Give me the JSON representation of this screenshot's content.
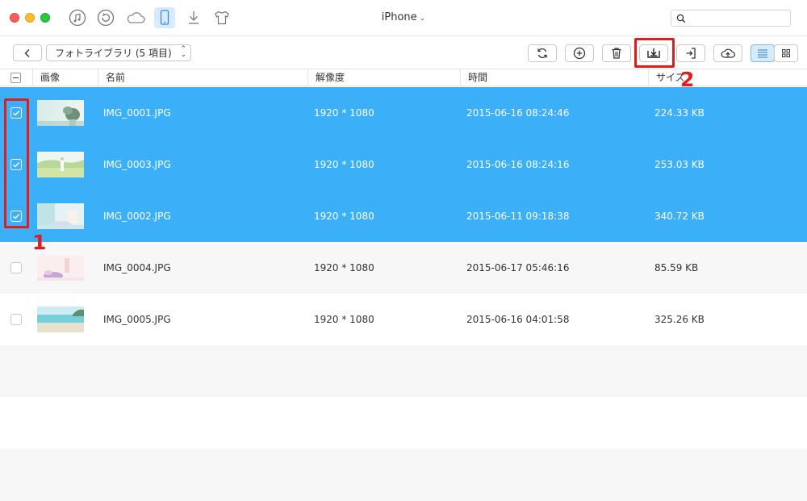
{
  "window": {
    "device_name": "iPhone",
    "device_chevron": "⌄"
  },
  "nav_icons": [
    "music-icon",
    "restore-icon",
    "icloud-icon",
    "iphone-icon",
    "download-icon",
    "tshirt-icon"
  ],
  "search": {
    "placeholder": ""
  },
  "toolbar": {
    "library_label": "フォトライブラリ (5 項目)",
    "buttons": [
      "refresh",
      "add",
      "delete",
      "export-to-computer",
      "import",
      "cloud-upload"
    ],
    "view_mode": "list"
  },
  "columns": {
    "image": "画像",
    "name": "名前",
    "resolution": "解像度",
    "time": "時間",
    "size": "サイズ"
  },
  "rows": [
    {
      "name": "IMG_0001.JPG",
      "resolution": "1920 * 1080",
      "time": "2015-06-16 08:24:46",
      "size": "224.33 KB",
      "selected": true
    },
    {
      "name": "IMG_0003.JPG",
      "resolution": "1920 * 1080",
      "time": "2015-06-16 08:24:16",
      "size": "253.03 KB",
      "selected": true
    },
    {
      "name": "IMG_0002.JPG",
      "resolution": "1920 * 1080",
      "time": "2015-06-11 09:18:38",
      "size": "340.72 KB",
      "selected": true
    },
    {
      "name": "IMG_0004.JPG",
      "resolution": "1920 * 1080",
      "time": "2015-06-17 05:46:16",
      "size": "85.59 KB",
      "selected": false
    },
    {
      "name": "IMG_0005.JPG",
      "resolution": "1920 * 1080",
      "time": "2015-06-16 04:01:58",
      "size": "325.26 KB",
      "selected": false
    }
  ],
  "annotations": {
    "step1": "1",
    "step2": "2"
  },
  "colors": {
    "selection": "#3bb0f9",
    "annotation_red": "#e21b1b"
  }
}
